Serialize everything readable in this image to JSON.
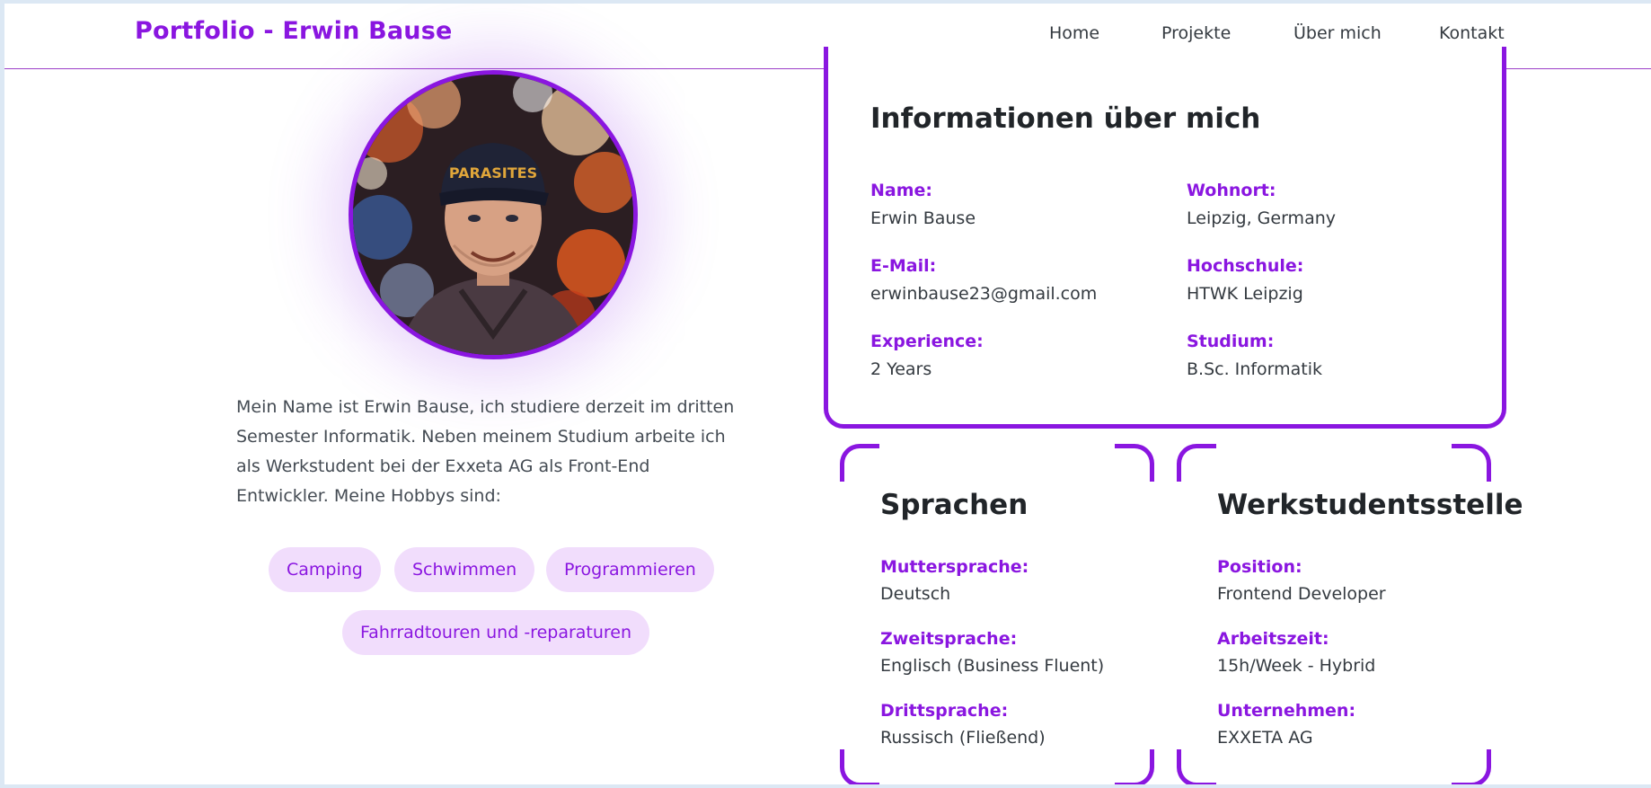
{
  "navbar": {
    "brand": "Portfolio - Erwin Bause",
    "links": [
      "Home",
      "Projekte",
      "Über mich",
      "Kontakt"
    ]
  },
  "profile": {
    "bio": "Mein Name ist Erwin Bause, ich studiere derzeit im dritten Semester Informatik. Neben meinem Studium arbeite ich als Werkstudent bei der Exxeta AG als Front-End Entwickler. Meine Hobbys sind:",
    "hobbies": [
      "Camping",
      "Schwimmen",
      "Programmieren",
      "Fahrradtouren und -reparaturen"
    ]
  },
  "info_card": {
    "title": "Informationen über mich",
    "fields": [
      {
        "label": "Name:",
        "value": "Erwin Bause"
      },
      {
        "label": "Wohnort:",
        "value": "Leipzig, Germany"
      },
      {
        "label": "E-Mail:",
        "value": "erwinbause23@gmail.com"
      },
      {
        "label": "Hochschule:",
        "value": "HTWK Leipzig"
      },
      {
        "label": "Experience:",
        "value": "2 Years"
      },
      {
        "label": "Studium:",
        "value": "B.Sc. Informatik"
      }
    ]
  },
  "languages_card": {
    "title": "Sprachen",
    "fields": [
      {
        "label": "Muttersprache:",
        "value": "Deutsch"
      },
      {
        "label": "Zweitsprache:",
        "value": "Englisch (Business Fluent)"
      },
      {
        "label": "Drittsprache:",
        "value": "Russisch (Fließend)"
      }
    ]
  },
  "job_card": {
    "title": "Werkstudentsstelle",
    "fields": [
      {
        "label": "Position:",
        "value": "Frontend Developer"
      },
      {
        "label": "Arbeitszeit:",
        "value": "15h/Week - Hybrid"
      },
      {
        "label": "Unternehmen:",
        "value": "EXXETA AG"
      }
    ]
  },
  "colors": {
    "accent": "#8a16e0",
    "hobby_bg": "#f1ddfc",
    "text": "#343a40",
    "heading": "#212529"
  }
}
